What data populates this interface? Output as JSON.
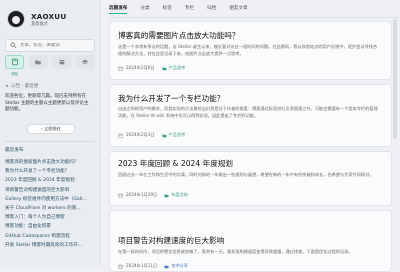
{
  "brand": {
    "name": "XAOXUU",
    "subtitle": "我是我才"
  },
  "search": {
    "placeholder": "文章、标签、关键词"
  },
  "quick_links": [
    {
      "icon": "book-icon",
      "label": "博客",
      "active": true
    },
    {
      "icon": "folder-icon",
      "label": "",
      "active": false
    },
    {
      "icon": "box-icon",
      "label": "",
      "active": false
    },
    {
      "icon": "layers-icon",
      "label": "",
      "active": false
    }
  ],
  "announcement": {
    "header": "公告 · 最近更",
    "text": "欢迎各位，更新得几篇。现已支持所有在 Stellar 主题的主题以主题更新以及评论主题功能。",
    "button": "立即前往"
  },
  "recent": {
    "header": "最近发布",
    "items": [
      "博客高的搜索图片点击放大功能吗？",
      "我为什么开发了一个专栏功能？",
      "2023 年度回顾 & 2024 年度规划",
      "项目警告对构建速度的巨大影响",
      "Gallery 标签组件内使用方法中（Gall...",
      "关于 CloudFlare 对 workers 的限...",
      "博客入门：每个人为自己博客",
      "博客功能：自由化积累",
      "GitHub Codespaces 构建流程",
      "开发 Stellar 博客时期高效的工作开..."
    ]
  },
  "tabs": [
    {
      "label": "近期发布",
      "active": true
    },
    {
      "label": "分类",
      "active": false
    },
    {
      "label": "标签",
      "active": false
    },
    {
      "label": "专栏",
      "active": false
    },
    {
      "label": "归档",
      "active": false
    },
    {
      "label": "朋友文章",
      "active": false
    }
  ],
  "posts": [
    {
      "title": "博客真的需要图片点击放大功能吗？",
      "excerpt": "这是一个非常有争议的话题，自 Stellar 诞生以来，被反复讨论过一段时间的问题。在此期间，我从其他站点的用户反馈中，逐步尝试寻找合理的解决方法，并在这里记录下来。给图片点击放大提供一点思考。",
      "date": "2024年2月6日",
      "category": "产品思考",
      "category_color": "#3a9b81"
    },
    {
      "title": "我为什么开发了一个专栏功能？",
      "excerpt": "自由达到的用户的需求，而其实现的方法最恰当仍然是对于作者的角度：博客通过标签进行文章管理之外，可能会需要有一个类似专栏的管理功能，在 Stellar 的 wiki 系统中也可以得到实现。因此提出了专栏的功能。",
      "date": "2024年2月3日",
      "category": "产品思考",
      "category_color": "#3a9b81"
    },
    {
      "title": "2023 年度回顾 & 2024 年度规划",
      "excerpt": "回顾过去一年在工作和生活中的点滴，同时对新的一年做出一些规划与展望，希望在新的一年中有所突破和成长，也希望与大家共同探讨。",
      "date": "2024年1月29日",
      "category": "年度总结",
      "category_color": "#3a9b81"
    },
    {
      "title": "项目警告对构建速度的巨大影响",
      "excerpt": "在我一段时间内，项目的警告信息被忽略了，直到有一天，我发现构建速度变得异常缓慢，通过排查，下面是优化过程的记录。",
      "date": "2024年1月11日",
      "category": "技术分享",
      "category_color": "#4a74c7"
    }
  ]
}
